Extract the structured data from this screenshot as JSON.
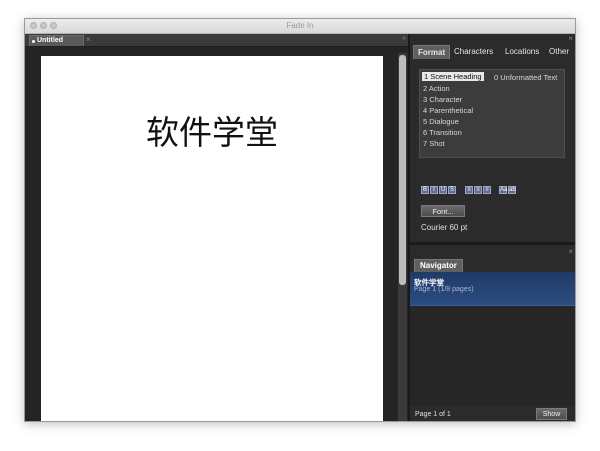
{
  "window": {
    "title": "Fade In"
  },
  "editor": {
    "tabs": [
      {
        "label": "Untitled"
      }
    ],
    "tab_close": "×",
    "overflow": "»",
    "page_text": "软件学堂"
  },
  "format_panel": {
    "close": "×",
    "tabs": [
      {
        "label": "Format"
      },
      {
        "label": "Characters"
      },
      {
        "label": "Locations"
      },
      {
        "label": "Other"
      }
    ],
    "active_tab": "Format",
    "styles": [
      "1 Scene Heading",
      "2 Action",
      "3 Character",
      "4 Parenthetical",
      "5 Dialogue",
      "6 Transition",
      "7 Shot"
    ],
    "selected_style": "1 Scene Heading",
    "unformatted": "0 Unformatted Text",
    "format_buttons": [
      "B",
      "I",
      "U",
      "S",
      "≡",
      "≡",
      "≡",
      "Aa",
      "ab"
    ],
    "font_button": "Font...",
    "font_desc": "Courier 60 pt"
  },
  "navigator_panel": {
    "close": "×",
    "tab": "Navigator",
    "items": [
      {
        "title": "软件学堂",
        "subtitle": "Page 1 (1/8 pages)"
      }
    ],
    "page_status": "Page 1 of 1",
    "show_button": "Show"
  },
  "colors": {
    "window_bg": "#2c2c2c",
    "selection_blue": "#2c4d82",
    "page_white": "#ffffff"
  }
}
